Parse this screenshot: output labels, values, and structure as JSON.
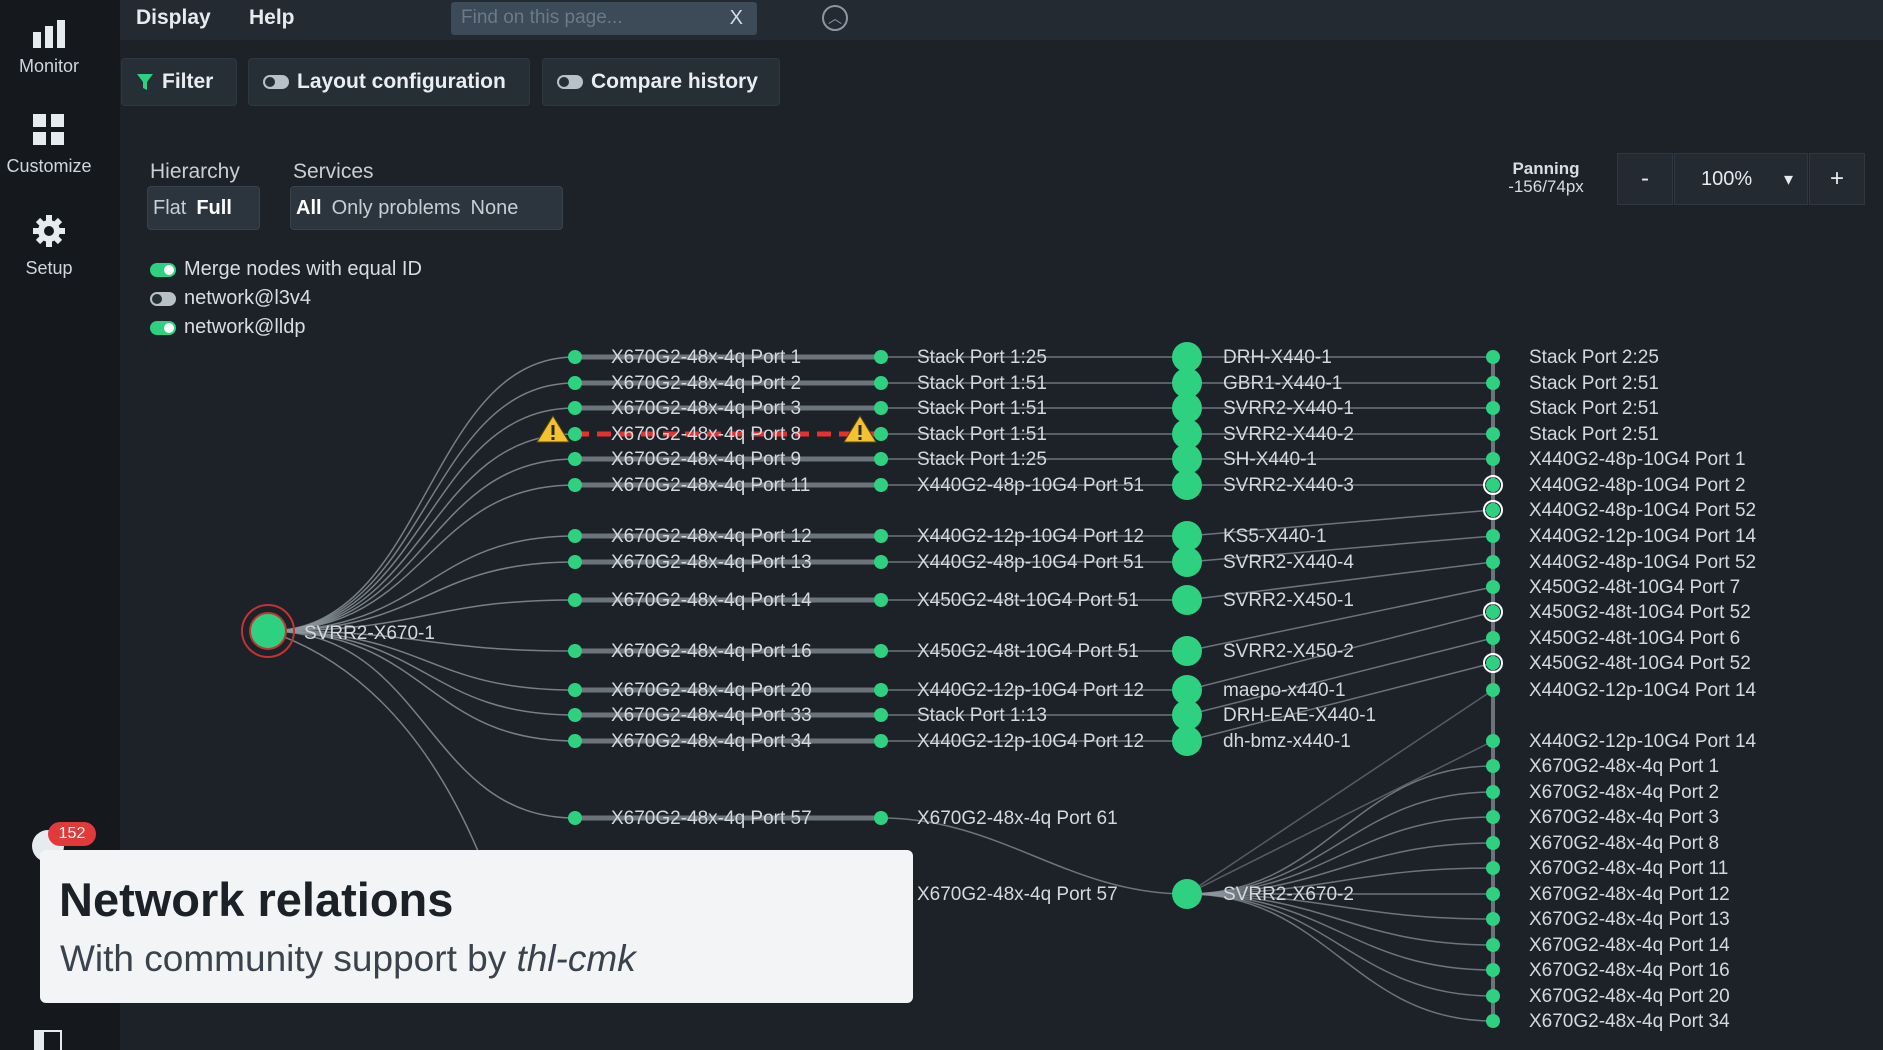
{
  "sidebar": {
    "items": [
      {
        "label": "Monitor",
        "icon": "bar-chart-icon"
      },
      {
        "label": "Customize",
        "icon": "grid-icon"
      },
      {
        "label": "Setup",
        "icon": "gear-icon"
      }
    ],
    "badge_count": "152"
  },
  "topbar": {
    "menus": [
      "Display",
      "Help"
    ],
    "search_placeholder": "Find on this page...",
    "search_clear": "X"
  },
  "toolbar": {
    "filter_label": "Filter",
    "layout_label": "Layout configuration",
    "compare_label": "Compare history"
  },
  "controls": {
    "hierarchy_label": "Hierarchy",
    "hierarchy_options": [
      "Flat",
      "Full"
    ],
    "hierarchy_selected": "Full",
    "services_label": "Services",
    "services_options": [
      "All",
      "Only problems",
      "None"
    ],
    "services_selected": "All",
    "toggles": [
      {
        "label": "Merge nodes with equal ID",
        "on": true
      },
      {
        "label": "network@l3v4",
        "on": false
      },
      {
        "label": "network@lldp",
        "on": true
      }
    ]
  },
  "viewport": {
    "panning_label": "Panning",
    "panning_value": "-156/74px",
    "zoom": "100%",
    "zoom_out": "-",
    "zoom_in": "+",
    "zoom_dropdown": "▾"
  },
  "graph": {
    "root": "SVRR2-X670-1",
    "root_ports": [
      "X670G2-48x-4q Port 1",
      "X670G2-48x-4q Port 2",
      "X670G2-48x-4q Port 3",
      "X670G2-48x-4q Port 8",
      "X670G2-48x-4q Port 9",
      "X670G2-48x-4q Port 11",
      "X670G2-48x-4q Port 12",
      "X670G2-48x-4q Port 13",
      "X670G2-48x-4q Port 14",
      "X670G2-48x-4q Port 16",
      "X670G2-48x-4q Port 20",
      "X670G2-48x-4q Port 33",
      "X670G2-48x-4q Port 34",
      "X670G2-48x-4q Port 57"
    ],
    "remote_ports": [
      "Stack Port 1:25",
      "Stack Port 1:51",
      "Stack Port 1:51",
      "Stack Port 1:51",
      "Stack Port 1:25",
      "X440G2-48p-10G4 Port 51",
      "X440G2-12p-10G4 Port 12",
      "X440G2-48p-10G4 Port 51",
      "X450G2-48t-10G4 Port 51",
      "X450G2-48t-10G4 Port 51",
      "X440G2-12p-10G4 Port 12",
      "Stack Port 1:13",
      "X440G2-12p-10G4 Port 12",
      "X670G2-48x-4q Port 61",
      "X670G2-48x-4q Port 57"
    ],
    "hosts": [
      "DRH-X440-1",
      "GBR1-X440-1",
      "SVRR2-X440-1",
      "SVRR2-X440-2",
      "SH-X440-1",
      "SVRR2-X440-3",
      "KS5-X440-1",
      "SVRR2-X440-4",
      "SVRR2-X450-1",
      "SVRR2-X450-2",
      "maepo-x440-1",
      "DRH-EAE-X440-1",
      "dh-bmz-x440-1",
      "SVRR2-X670-2"
    ],
    "host_ports": [
      "Stack Port 2:25",
      "Stack Port 2:51",
      "Stack Port 2:51",
      "Stack Port 2:51",
      "X440G2-48p-10G4 Port 1",
      "X440G2-48p-10G4 Port 2",
      "X440G2-48p-10G4 Port 52",
      "X440G2-12p-10G4 Port 14",
      "X440G2-48p-10G4 Port 52",
      "X450G2-48t-10G4 Port 7",
      "X450G2-48t-10G4 Port 52",
      "X450G2-48t-10G4 Port 6",
      "X450G2-48t-10G4 Port 52",
      "X440G2-12p-10G4 Port 14",
      "X440G2-12p-10G4 Port 14",
      "X670G2-48x-4q Port 1",
      "X670G2-48x-4q Port 2",
      "X670G2-48x-4q Port 3",
      "X670G2-48x-4q Port 8",
      "X670G2-48x-4q Port 11",
      "X670G2-48x-4q Port 12",
      "X670G2-48x-4q Port 13",
      "X670G2-48x-4q Port 14",
      "X670G2-48x-4q Port 16",
      "X670G2-48x-4q Port 20",
      "X670G2-48x-4q Port 34"
    ]
  },
  "notification": {
    "title": "Network relations",
    "subtitle_prefix": "With community support by ",
    "subtitle_author": "thl-cmk"
  },
  "colors": {
    "node": "#2ed17f",
    "warning": "#f2c230",
    "error_link": "#e8302e"
  }
}
